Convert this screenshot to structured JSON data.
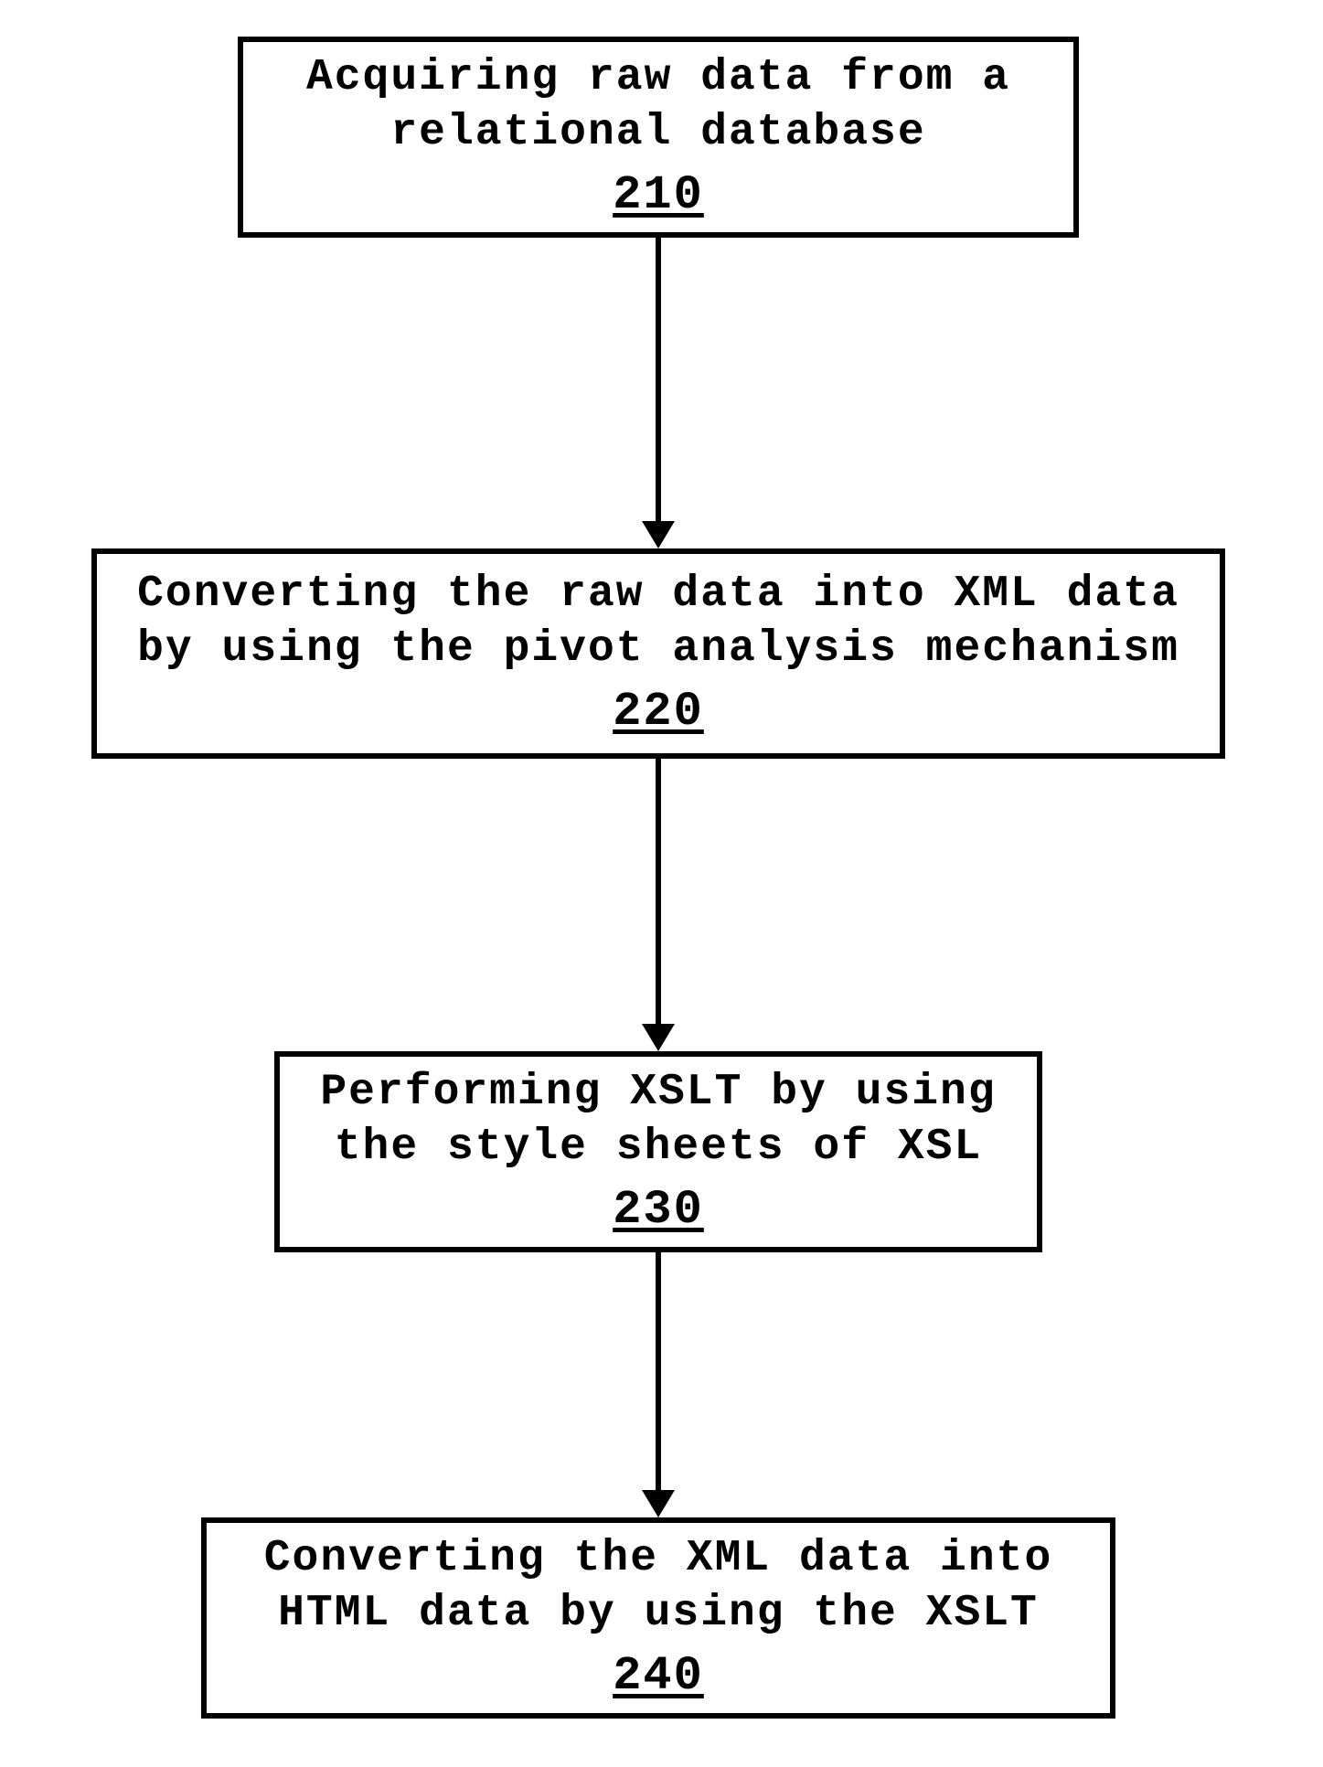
{
  "flow": {
    "steps": [
      {
        "id": "210",
        "text": "Acquiring raw data from a\nrelational database",
        "num": "210"
      },
      {
        "id": "220",
        "text": "Converting the raw data into XML data\nby using the pivot analysis mechanism",
        "num": "220"
      },
      {
        "id": "230",
        "text": "Performing XSLT by using\nthe style sheets of XSL",
        "num": "230"
      },
      {
        "id": "240",
        "text": "Converting the XML data into\nHTML data by using the XSLT",
        "num": "240"
      }
    ]
  }
}
